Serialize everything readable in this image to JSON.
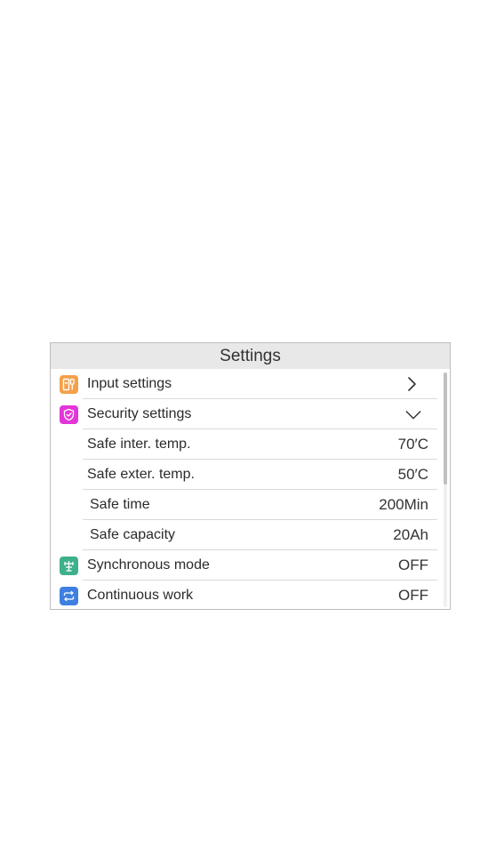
{
  "header": {
    "title": "Settings"
  },
  "rows": [
    {
      "label": "Input settings",
      "icon": "input-settings-icon",
      "accent": "#f5a04a"
    },
    {
      "label": "Security settings",
      "icon": "shield-icon",
      "accent": "#e236d8"
    },
    {
      "label": "Safe inter. temp.",
      "value": "70′C"
    },
    {
      "label": "Safe exter. temp.",
      "value": "50′C"
    },
    {
      "label": "Safe time",
      "value": "200Min"
    },
    {
      "label": "Safe capacity",
      "value": "20Ah"
    },
    {
      "label": "Synchronous mode",
      "value": "OFF",
      "icon": "sync-mode-icon",
      "accent": "#3fb08c"
    },
    {
      "label": "Continuous work",
      "value": "OFF",
      "icon": "repeat-icon",
      "accent": "#3f7fe0"
    }
  ]
}
